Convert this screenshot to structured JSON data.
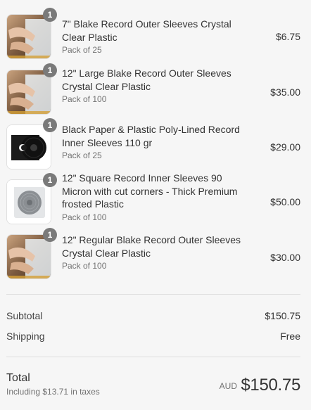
{
  "items": [
    {
      "quantity": "1",
      "title": "7\" Blake Record Outer Sleeves Crystal Clear Plastic",
      "variant": "Pack of 25",
      "price": "$6.75",
      "image_icon": "clear-sleeve-photo"
    },
    {
      "quantity": "1",
      "title": "12\" Large Blake Record Outer Sleeves Crystal Clear Plastic",
      "variant": "Pack of 100",
      "price": "$35.00",
      "image_icon": "clear-sleeve-photo"
    },
    {
      "quantity": "1",
      "title": "Black Paper & Plastic Poly-Lined Record Inner Sleeves 110 gr",
      "variant": "Pack of 25",
      "price": "$29.00",
      "image_icon": "black-inner-sleeve-photo"
    },
    {
      "quantity": "1",
      "title": "12\" Square Record Inner Sleeves 90 Micron with cut corners - Thick Premium frosted Plastic",
      "variant": "Pack of 100",
      "price": "$50.00",
      "image_icon": "frosted-inner-sleeve-photo"
    },
    {
      "quantity": "1",
      "title": "12\" Regular Blake Record Outer Sleeves Crystal Clear Plastic",
      "variant": "Pack of 100",
      "price": "$30.00",
      "image_icon": "clear-sleeve-photo"
    }
  ],
  "subtotal": {
    "label": "Subtotal",
    "value": "$150.75"
  },
  "shipping": {
    "label": "Shipping",
    "value": "Free"
  },
  "total": {
    "label": "Total",
    "tax_note": "Including $13.71 in taxes",
    "currency": "AUD",
    "value": "$150.75"
  }
}
